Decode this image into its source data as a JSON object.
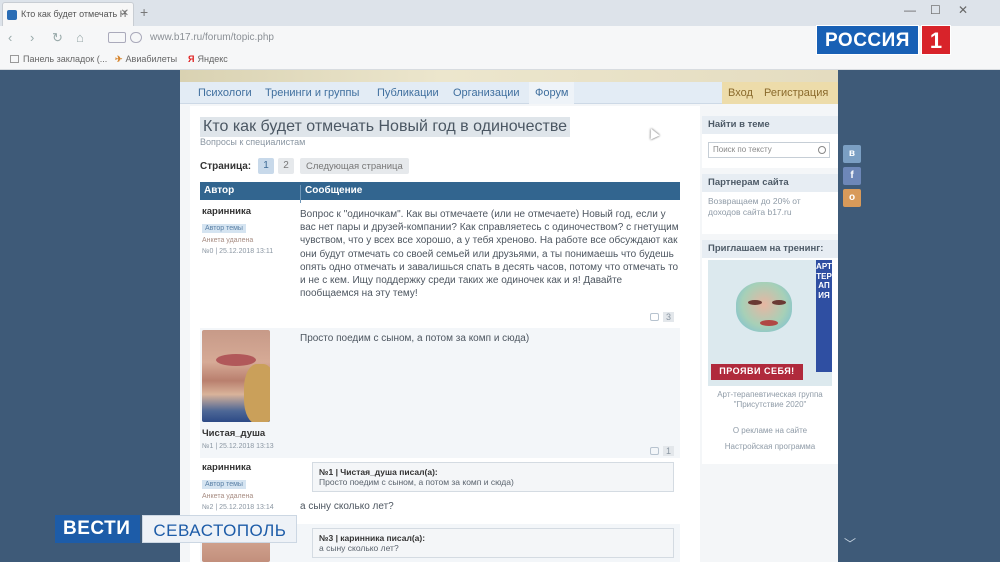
{
  "browser": {
    "tab_title": "Кто как будет отмечать Н",
    "url": "www.b17.ru/forum/topic.php",
    "bookmarks": [
      {
        "label": "Панель закладок (..."
      },
      {
        "label": "Авиабилеты"
      },
      {
        "label": "Яндекс"
      }
    ]
  },
  "tv": {
    "channel": "РОССИЯ",
    "channel_number": "1",
    "program": "ВЕСТИ",
    "city": "СЕВАСТОПОЛЬ"
  },
  "site_nav": {
    "items": [
      "Психологи",
      "Тренинги и группы",
      "Публикации",
      "Организации"
    ],
    "active": "Форум",
    "login": "Вход",
    "register": "Регистрация"
  },
  "topic": {
    "title": "Кто как будет отмечать Новый год в одиночестве",
    "subtitle": "Вопросы к специалистам"
  },
  "pager": {
    "label": "Страница:",
    "pages": [
      "1",
      "2"
    ],
    "next": "Следующая страница"
  },
  "table": {
    "col_author": "Автор",
    "col_message": "Сообщение"
  },
  "posts": [
    {
      "author": "каринника",
      "badge": "Автор темы",
      "status": "Анкета удалена",
      "meta": "№0 | 25.12.2018 13:11",
      "body": "Вопрос к \"одиночкам\". Как вы отмечаете (или не отмечаете) Новый год, если у вас нет пары и друзей-компании? Как справляетесь с одиночеством? с гнетущим чувством, что у всех все хорошо, а у тебя хреново. На работе все обсуждают как они будут отмечать со своей семьей или друзьями, а ты понимаешь что будешь опять одно отмечать и завалишься спать в десять часов, потому что отмечать то и не с кем. Ищу поддержку среди таких же одиночек как и я! Давайте пообщаемся на эту тему!",
      "likes": "3"
    },
    {
      "author": "Чистая_душа",
      "meta": "№1 | 25.12.2018 13:13",
      "body": "Просто поедим с сыном, а потом за комп и сюда)",
      "likes": "1"
    },
    {
      "author": "каринника",
      "badge": "Автор темы",
      "status": "Анкета удалена",
      "meta": "№2 | 25.12.2018 13:14",
      "quote_head": "№1 | Чистая_душа писал(а):",
      "quote_text": "Просто поедим с сыном, а потом за комп и сюда)",
      "body": "а сыну сколько лет?"
    },
    {
      "quote_head": "№3 | каринника писал(а):",
      "quote_text": "а сыну сколько лет?"
    }
  ],
  "sidebar": {
    "search_title": "Найти в теме",
    "search_placeholder": "Поиск по тексту",
    "partners_title": "Партнерам сайта",
    "partners_text": "Возвращаем до 20% от доходов сайта b17.ru",
    "ad_title": "Приглашаем на тренинг:",
    "ad_vertical": "АРТ ТЕРАПИЯ",
    "ad_banner": "ПРОЯВИ СЕБЯ!",
    "ad_caption": "Арт-терапевтическая группа \"Присутствие 2020\"",
    "ad_link1": "О рекламе на сайте",
    "ad_link2": "Настройская программа"
  },
  "colors": {
    "table_header": "#32658f",
    "nav_link": "#3f6f9e",
    "tv_blue": "#1d5ca8",
    "tv_red": "#d8232a"
  }
}
